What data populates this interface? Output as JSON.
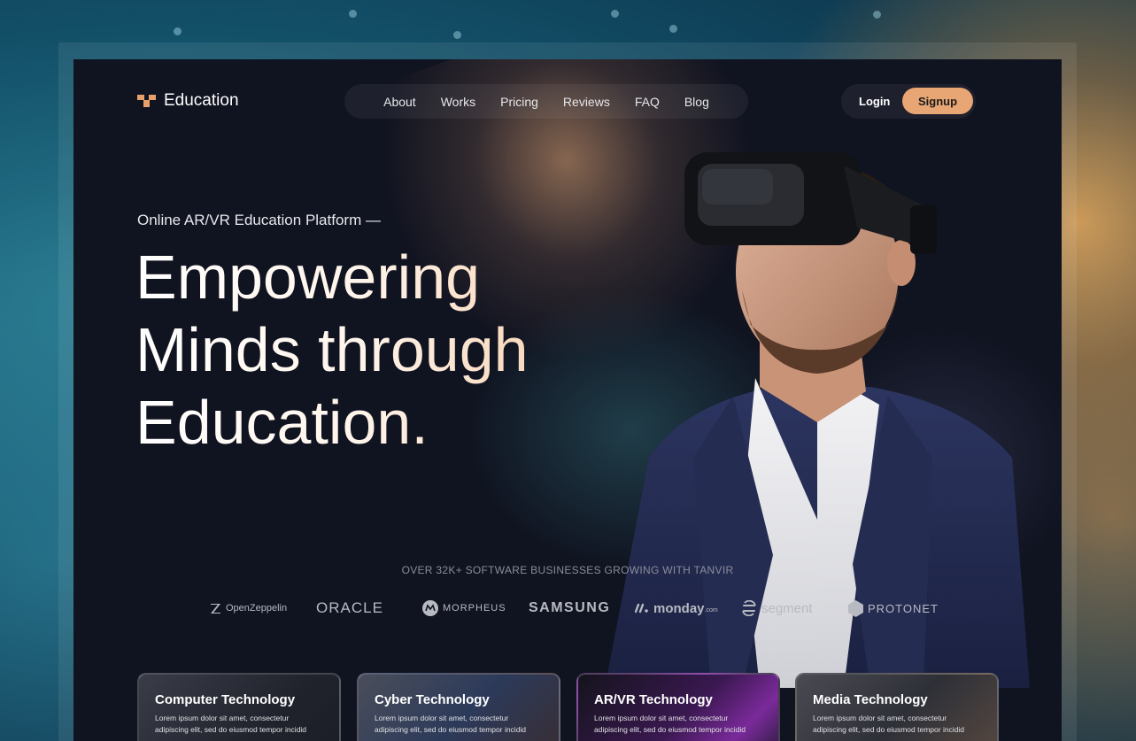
{
  "brand": {
    "name": "Education",
    "accent": "#e8a674"
  },
  "nav": {
    "items": [
      "About",
      "Works",
      "Pricing",
      "Reviews",
      "FAQ",
      "Blog"
    ],
    "login_label": "Login",
    "signup_label": "Signup"
  },
  "hero": {
    "eyebrow": "Online AR/VR Education Platform —",
    "headline_line1": "Empowering",
    "headline_line2": "Minds through",
    "headline_line3": "Education."
  },
  "trusted": {
    "text": "OVER 32K+ SOFTWARE  BUSINESSES GROWING WITH TANVIR",
    "brands": [
      "OpenZeppelin",
      "ORACLE",
      "MORPHEUS",
      "SAMSUNG",
      "monday",
      ".com",
      "segment",
      "PROTONET"
    ]
  },
  "cards": [
    {
      "title": "Computer Technology",
      "desc": "Lorem ipsum dolor sit amet, consectetur adipiscing elit, sed do eiusmod tempor incidid",
      "icon": "computer-technology-image"
    },
    {
      "title": "Cyber Technology",
      "desc": "Lorem ipsum dolor sit amet, consectetur adipiscing elit, sed do eiusmod tempor incidid",
      "icon": "cyber-technology-image"
    },
    {
      "title": "AR/VR Technology",
      "desc": "Lorem ipsum dolor sit amet, consectetur adipiscing elit, sed do eiusmod tempor incidid",
      "icon": "arvr-technology-image"
    },
    {
      "title": "Media Technology",
      "desc": "Lorem ipsum dolor sit amet, consectetur adipiscing elit, sed do eiusmod tempor incidid",
      "icon": "media-technology-image"
    }
  ]
}
